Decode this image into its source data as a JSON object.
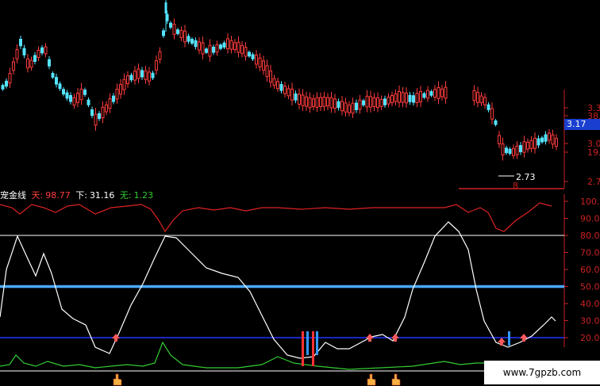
{
  "price_panel": {
    "axis_labels": [
      "3.35",
      "38.2%",
      "3.17",
      "3.02",
      "19.1%",
      "2.70"
    ],
    "current_price": "3.17",
    "low_annotation": "2.73",
    "low_marker": "8"
  },
  "indicator_panel": {
    "name": "宠金线",
    "legend": [
      {
        "key": "天:",
        "value": "98.77",
        "color": "#ff3b3b"
      },
      {
        "key": "下:",
        "value": "31.16",
        "color": "#ffffff"
      },
      {
        "key": "无:",
        "value": "1.23",
        "color": "#33cc33"
      }
    ],
    "axis_labels": [
      "100.00",
      "90.00",
      "80.00",
      "70.00",
      "60.00",
      "50.00",
      "40.00",
      "30.00",
      "20.00"
    ],
    "upper_level": 80,
    "middle_level": 50,
    "lower_level": 20
  },
  "watermark": "www.7gpzb.com",
  "colors": {
    "up": "#ff3b3b",
    "down": "#54e3ff",
    "axis": "#cc2222",
    "white_line": "#ffffff",
    "blue_band": "#4aa8ff",
    "low_band": "#2233ff",
    "green_line": "#33cc33",
    "red_line": "#dd2222"
  },
  "icons": {
    "buy_signal": "up-arrow-icon",
    "hand": "hand-pointer-icon"
  }
}
